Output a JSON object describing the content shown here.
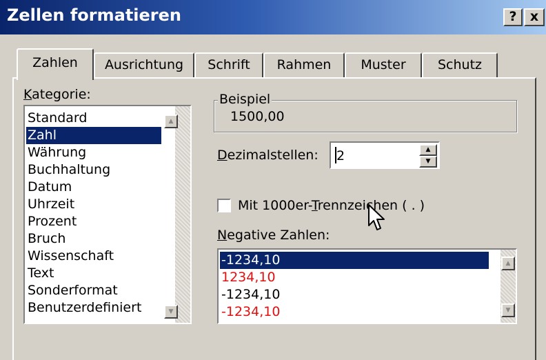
{
  "window": {
    "title": "Zellen formatieren",
    "help_label": "?",
    "close_label": "x"
  },
  "tabs": [
    {
      "label": "Zahlen",
      "active": true
    },
    {
      "label": "Ausrichtung"
    },
    {
      "label": "Schrift"
    },
    {
      "label": "Rahmen"
    },
    {
      "label": "Muster"
    },
    {
      "label": "Schutz"
    }
  ],
  "kategorie": {
    "label_hotkey": "K",
    "label_rest": "ategorie:",
    "items": [
      "Standard",
      "Zahl",
      "Währung",
      "Buchhaltung",
      "Datum",
      "Uhrzeit",
      "Prozent",
      "Bruch",
      "Wissenschaft",
      "Text",
      "Sonderformat",
      "Benutzerdefiniert"
    ],
    "selected": "Zahl"
  },
  "beispiel": {
    "label": "Beispiel",
    "value": "1500,00"
  },
  "dezimalstellen": {
    "label_hotkey": "D",
    "label_rest": "ezimalstellen:",
    "value": "2"
  },
  "tausender": {
    "label_pre": "Mit 1000er-",
    "label_hotkey": "T",
    "label_post": "rennzeichen ( . )",
    "checked": false
  },
  "negative": {
    "label_hotkey": "N",
    "label_rest": "egative Zahlen:",
    "items": [
      {
        "text": "-1234,10",
        "color": "#000000",
        "selected": true
      },
      {
        "text": "1234,10",
        "color": "#e01010"
      },
      {
        "text": "-1234,10",
        "color": "#000000"
      },
      {
        "text": "-1234,10",
        "color": "#e01010"
      }
    ]
  },
  "icons": {
    "scroll_up": "scroll-up-arrow-icon",
    "scroll_down": "scroll-down-arrow-icon",
    "spin_up": "spin-up-arrow-icon",
    "spin_down": "spin-down-arrow-icon",
    "cursor": "mouse-pointer-icon"
  }
}
